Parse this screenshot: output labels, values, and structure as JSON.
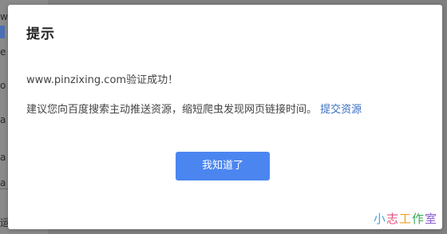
{
  "background": {
    "fragments": [
      "w",
      "e",
      "o",
      "a",
      "a",
      "a",
      "运"
    ]
  },
  "dialog": {
    "title": "提示",
    "domain_message": "www.pinzixing.com验证成功！",
    "suggestion_text": "建议您向百度搜索主动推送资源，缩短爬虫发现网页链接时间。",
    "submit_link_label": "提交资源",
    "ok_button_label": "我知道了"
  },
  "watermark": {
    "chars": [
      "小",
      "志",
      "工",
      "作",
      "室"
    ]
  },
  "colors": {
    "primary_button": "#4b86f0",
    "link": "#3a6fc4",
    "backdrop": "#808080"
  }
}
